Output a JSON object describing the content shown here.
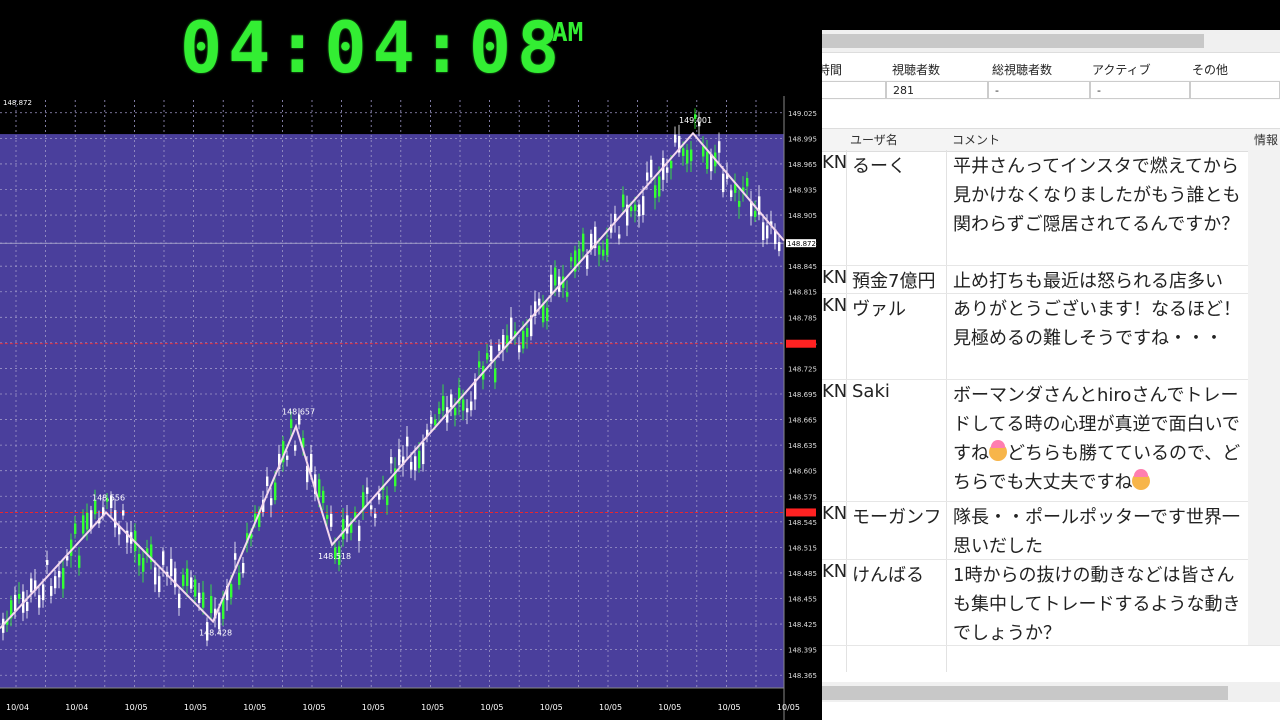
{
  "clock": {
    "time": "04:04:08",
    "ampm": "AM"
  },
  "chart": {
    "top_left_label": "148.872",
    "price_labels": [
      "149.025",
      "148.995",
      "148.965",
      "148.935",
      "148.905",
      "148.872",
      "148.845",
      "148.815",
      "148.785",
      "148.755",
      "148.725",
      "148.695",
      "148.665",
      "148.635",
      "148.605",
      "148.575",
      "148.545",
      "148.515",
      "148.485",
      "148.455",
      "148.425",
      "148.395",
      "148.365"
    ],
    "date_labels": [
      "10/04",
      "10/04",
      "10/05",
      "10/05",
      "10/05",
      "10/05",
      "10/05",
      "10/05",
      "10/05",
      "10/05",
      "10/05",
      "10/05",
      "10/05",
      "10/05"
    ],
    "pivots": [
      {
        "label": "148.556",
        "price": 148.556
      },
      {
        "label": "148.428",
        "price": 148.428
      },
      {
        "label": "148.657",
        "price": 148.657
      },
      {
        "label": "148.518",
        "price": 148.518
      },
      {
        "label": "149.001",
        "price": 149.001
      }
    ],
    "current_price_label": "148.872",
    "red_line_prices": [
      148.754,
      148.556
    ],
    "colors": {
      "background": "#4a3f9c",
      "bull": "#33ff33",
      "zigzag": "#f4d8ee",
      "grid": "#ffffff",
      "red": "#ff2222"
    }
  },
  "stats": {
    "headers": [
      "時間",
      "視聴者数",
      "総視聴者数",
      "アクティブ",
      "その他"
    ],
    "values": [
      "",
      "281",
      "-",
      "-",
      ""
    ]
  },
  "comments": {
    "headers": {
      "user": "ユーザ名",
      "comment": "コメント",
      "info": "情報"
    },
    "rows": [
      {
        "id": "KN",
        "user": "るーく",
        "comment": "平井さんってインスタで燃えてから見かけなくなりましたがもう誰とも関わらずご隠居されてるんですか？"
      },
      {
        "id": "KN",
        "user": "預金7億円",
        "comment": "止め打ちも最近は怒られる店多い"
      },
      {
        "id": "KN",
        "user": "ヴァル",
        "comment": "ありがとうございます！なるほど！見極めるの難しそうですね・・・"
      },
      {
        "id": "KN",
        "user": "Saki",
        "comment_parts": [
          "ボーマンダさんとhiroさんでトレードしてる時の心理が真逆で面白いですね",
          "どちらも勝てているので、どちらでも大丈夫ですね",
          ""
        ]
      },
      {
        "id": "KN",
        "user": "モーガンフ",
        "comment": "隊長・・ポールポッターです世界一思いだした"
      },
      {
        "id": "KN",
        "user": "けんばる",
        "comment": "1時からの抜けの動きなどは皆さんも集中してトレードするような動きでしょうか？"
      }
    ]
  }
}
